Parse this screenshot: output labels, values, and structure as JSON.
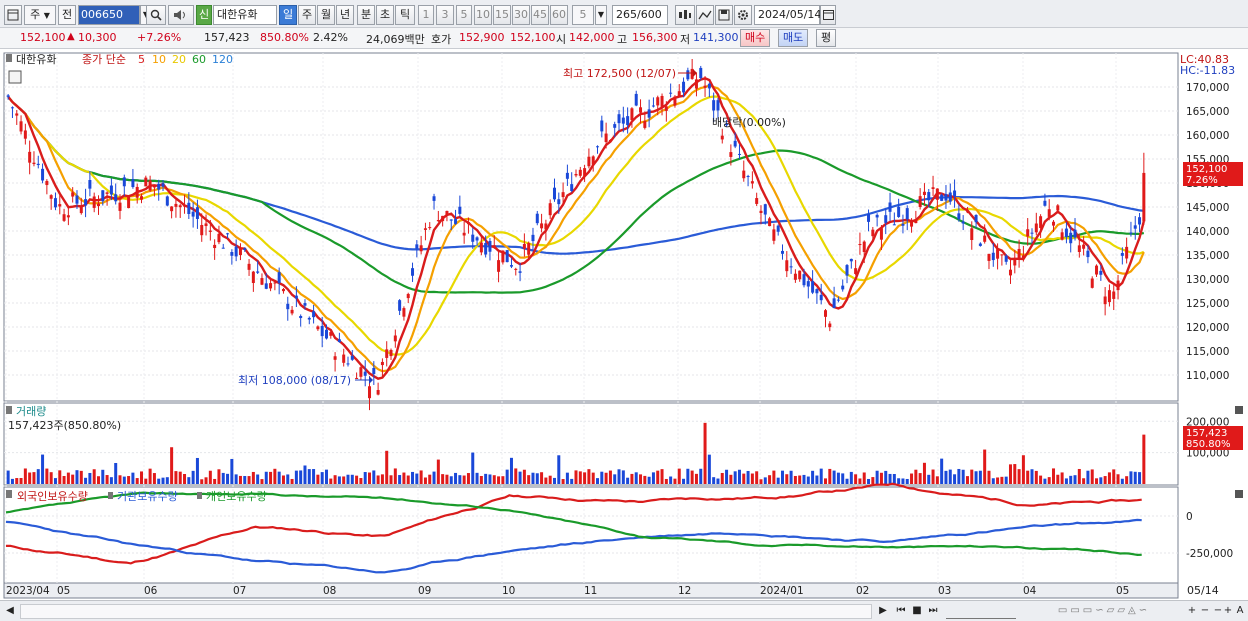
{
  "toolbar": {
    "period_main": "주",
    "prev_label": "전",
    "code": "006650",
    "stock_name": "대한유화",
    "new_badge": "신",
    "periods": [
      "일",
      "주",
      "월",
      "년",
      "분",
      "초",
      "틱"
    ],
    "active_period": "일",
    "minute_options": [
      "1",
      "3",
      "5",
      "10",
      "15",
      "30",
      "45",
      "60"
    ],
    "tick_value": "5",
    "count_value": "265",
    "count_max": "/600",
    "date_value": "2024/05/14"
  },
  "info": {
    "price": "152,100",
    "change": "10,300",
    "change_pct": "+7.26%",
    "volume": "157,423",
    "volume_pct": "850.80%",
    "turnover": "2.42%",
    "amount": "24,069백만",
    "quote_label": "호가",
    "ask": "152,900",
    "bid": "152,100",
    "open_label": "시",
    "open": "142,000",
    "high_label": "고",
    "high": "156,300",
    "low_label": "저",
    "low": "141,300",
    "buy_label": "매수",
    "sell_label": "매도",
    "avg_label": "평"
  },
  "price_panel": {
    "title": "대한유화",
    "ma_label": "종가 단순",
    "ma_periods": [
      "5",
      "10",
      "20",
      "60",
      "120"
    ],
    "ma_colors": [
      "#d91c1c",
      "#f5a000",
      "#e8d800",
      "#1a9a2a",
      "#2a5bd7"
    ],
    "lc": "LC:40.83",
    "hc": "HC:-11.83",
    "high_note": "최고 172,500 (12/07)",
    "low_note": "최저 108,000 (08/17)",
    "dividend_note": "배당락(0.00%)",
    "last_price": "152,100",
    "last_pct": "7.26%",
    "yaxis_labels": [
      "170,000",
      "165,000",
      "160,000",
      "155,000",
      "150,000",
      "145,000",
      "140,000",
      "135,000",
      "130,000",
      "125,000",
      "120,000",
      "115,000",
      "110,000"
    ]
  },
  "volume_panel": {
    "title": "거래량",
    "value_note": "157,423주(850.80%)",
    "last_volume": "157,423",
    "last_pct": "850.80%",
    "yaxis_labels": [
      "200,000",
      "100,000"
    ]
  },
  "holding_panel": {
    "legends": [
      "외국인보유수량",
      "기관보유수량",
      "개인보유수량"
    ],
    "legend_colors": [
      "#d91c1c",
      "#2a5bd7",
      "#1a9a2a"
    ],
    "yaxis_labels": [
      "0",
      "-250,000"
    ]
  },
  "xaxis": {
    "labels": [
      "2023/04",
      "05",
      "06",
      "07",
      "08",
      "09",
      "10",
      "11",
      "12",
      "2024/01",
      "02",
      "03",
      "04",
      "05"
    ],
    "end_label": "05/14"
  },
  "chart_data": {
    "type": "candlestick",
    "title": "대한유화",
    "ylim": [
      105000,
      175000
    ],
    "x_range": [
      "2023/04",
      "2024/05/14"
    ],
    "ma_periods": [
      5,
      10,
      20,
      60,
      120
    ],
    "anchor_closes": [
      {
        "date": "2023/04",
        "close": 168000
      },
      {
        "date": "2023/05",
        "close": 145000
      },
      {
        "date": "2023/06",
        "close": 150000
      },
      {
        "date": "2023/07",
        "close": 135000
      },
      {
        "date": "2023/08/17",
        "close": 108000,
        "note": "최저"
      },
      {
        "date": "2023/09",
        "close": 145000
      },
      {
        "date": "2023/10",
        "close": 133000
      },
      {
        "date": "2023/11",
        "close": 158000
      },
      {
        "date": "2023/12/07",
        "close": 172500,
        "note": "최고"
      },
      {
        "date": "2024/01",
        "close": 140000
      },
      {
        "date": "2024/01/20",
        "close": 122000
      },
      {
        "date": "2024/02",
        "close": 140000
      },
      {
        "date": "2024/03",
        "close": 148000
      },
      {
        "date": "2024/03/20",
        "close": 131000
      },
      {
        "date": "2024/04",
        "close": 146000
      },
      {
        "date": "2024/04/25",
        "close": 126000
      },
      {
        "date": "2024/05/14",
        "close": 152100
      }
    ],
    "last": {
      "open": 142000,
      "high": 156300,
      "low": 141300,
      "close": 152100,
      "volume": 157423
    }
  }
}
